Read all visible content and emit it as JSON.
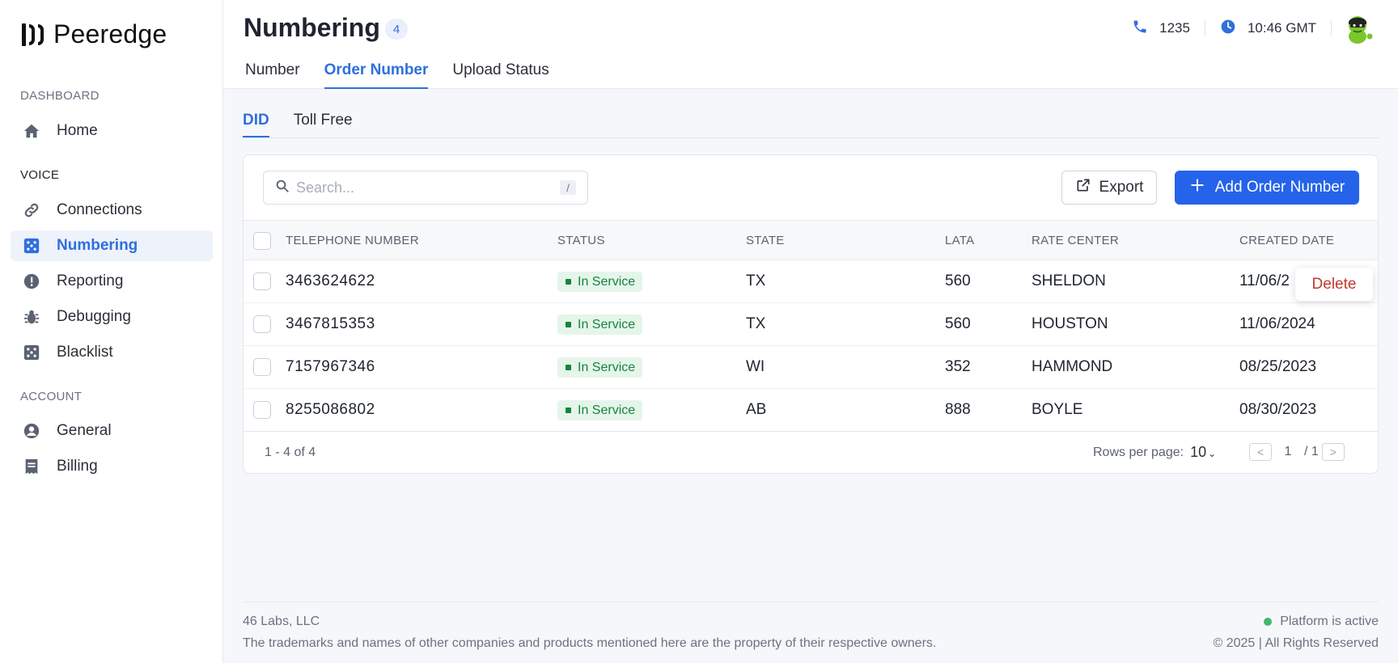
{
  "app": {
    "name": "Peeredge"
  },
  "sidebar": {
    "sections": [
      {
        "label": "DASHBOARD"
      },
      {
        "label": "VOICE"
      },
      {
        "label": "ACCOUNT"
      }
    ],
    "items": [
      {
        "label": "Home",
        "icon": "home-icon"
      },
      {
        "label": "Connections",
        "icon": "link-icon"
      },
      {
        "label": "Numbering",
        "icon": "dice-icon",
        "active": true
      },
      {
        "label": "Reporting",
        "icon": "alert-icon"
      },
      {
        "label": "Debugging",
        "icon": "bug-icon"
      },
      {
        "label": "Blacklist",
        "icon": "dice-icon"
      },
      {
        "label": "General",
        "icon": "user-circle-icon"
      },
      {
        "label": "Billing",
        "icon": "receipt-icon"
      }
    ]
  },
  "header": {
    "title": "Numbering",
    "count": "4",
    "tabs": [
      {
        "label": "Number"
      },
      {
        "label": "Order Number",
        "active": true
      },
      {
        "label": "Upload Status"
      }
    ],
    "phone": "1235",
    "time": "10:46 GMT"
  },
  "subtabs": [
    {
      "label": "DID",
      "active": true
    },
    {
      "label": "Toll Free"
    }
  ],
  "toolbar": {
    "search_placeholder": "Search...",
    "search_shortcut": "/",
    "export_label": "Export",
    "add_label": "Add Order Number"
  },
  "table": {
    "columns": [
      "TELEPHONE NUMBER",
      "STATUS",
      "STATE",
      "LATA",
      "RATE CENTER",
      "CREATED DATE"
    ],
    "rows": [
      {
        "number": "3463624622",
        "status": "In Service",
        "state": "TX",
        "lata": "560",
        "rate_center": "SHELDON",
        "created": "11/06/2"
      },
      {
        "number": "3467815353",
        "status": "In Service",
        "state": "TX",
        "lata": "560",
        "rate_center": "HOUSTON",
        "created": "11/06/2024"
      },
      {
        "number": "7157967346",
        "status": "In Service",
        "state": "WI",
        "lata": "352",
        "rate_center": "HAMMOND",
        "created": "08/25/2023"
      },
      {
        "number": "8255086802",
        "status": "In Service",
        "state": "AB",
        "lata": "888",
        "rate_center": "BOYLE",
        "created": "08/30/2023"
      }
    ],
    "context_menu": {
      "label": "Delete"
    },
    "range_text": "1 - 4 of 4",
    "rows_per_page_label": "Rows per page:",
    "rows_per_page_value": "10",
    "page_current": "1",
    "page_total": "/ 1"
  },
  "footer": {
    "company": "46 Labs, LLC",
    "disclaimer": "The trademarks and names of other companies and products mentioned here are the property of their respective owners.",
    "status": "Platform is active",
    "copyright": "© 2025 | All Rights Reserved"
  },
  "colors": {
    "accent": "#2f6fde",
    "primary_button": "#2563eb",
    "success": "#17843e",
    "danger": "#c0392b"
  }
}
